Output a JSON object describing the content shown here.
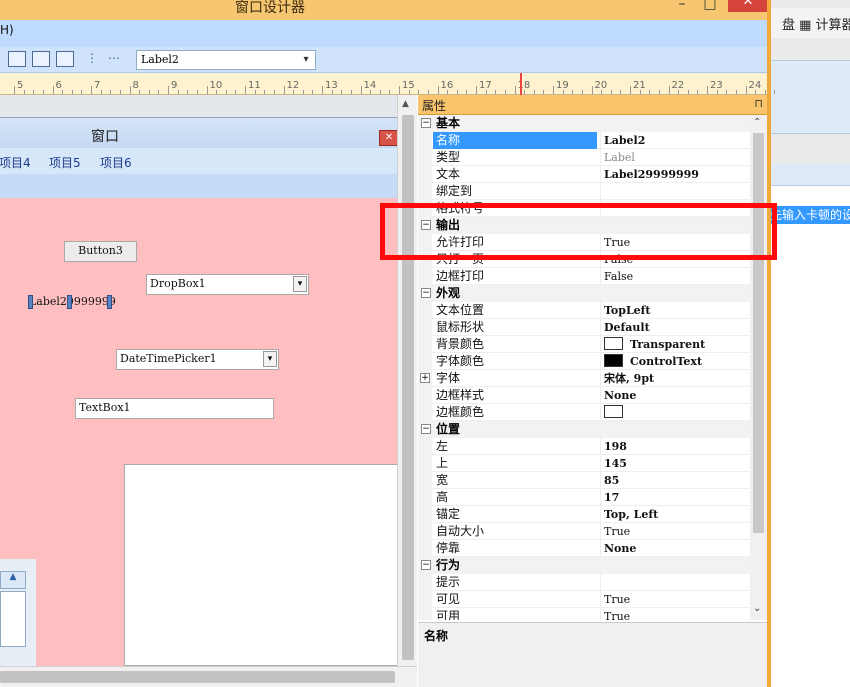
{
  "window": {
    "title": "窗口设计器",
    "min": "–",
    "max": "□",
    "close": "✕"
  },
  "outer": {
    "toolbar_text": "盘  ▦ 计算器",
    "selected_text": "先输入卡顿的设"
  },
  "menu": {
    "partial_item": "H)"
  },
  "toolbar": {
    "combo_value": "Label2",
    "combo_arrow": "▾"
  },
  "ruler": {
    "labels": [
      "5",
      "6",
      "7",
      "8",
      "9",
      "10",
      "11",
      "12",
      "13",
      "14",
      "15",
      "16",
      "17",
      "18",
      "19",
      "20",
      "21",
      "22",
      "23",
      "24"
    ]
  },
  "form": {
    "title": "窗口",
    "close": "✕",
    "menu_items": [
      "项目4",
      "项目5",
      "项目6"
    ],
    "controls": {
      "button3": "Button3",
      "dropbox": "DropBox1",
      "label2": "Label29999999",
      "datetime": "DateTimePicker1",
      "textbox": "TextBox1"
    },
    "lp_btn": "▲"
  },
  "properties": {
    "header": "属性",
    "pin": "⊓",
    "categories": [
      {
        "name": "基本",
        "rows": [
          {
            "name": "名称",
            "value": "Label2",
            "bold": true,
            "selected": true
          },
          {
            "name": "类型",
            "value": "Label",
            "grey": true
          },
          {
            "name": "文本",
            "value": "Label29999999",
            "bold": true
          },
          {
            "name": "绑定到",
            "value": ""
          },
          {
            "name": "格式符号",
            "value": ""
          }
        ]
      },
      {
        "name": "输出",
        "rows": [
          {
            "name": "允许打印",
            "value": "True"
          },
          {
            "name": "只打一页",
            "value": "False"
          },
          {
            "name": "边框打印",
            "value": "False"
          }
        ]
      },
      {
        "name": "外观",
        "rows": [
          {
            "name": "文本位置",
            "value": "TopLeft",
            "bold": true
          },
          {
            "name": "鼠标形状",
            "value": "Default",
            "bold": true
          },
          {
            "name": "背景颜色",
            "value": "Transparent",
            "bold": true,
            "swatch": "#ffffff"
          },
          {
            "name": "字体颜色",
            "value": "ControlText",
            "bold": true,
            "swatch": "#000000"
          },
          {
            "name": "字体",
            "value": "宋体, 9pt",
            "bold": true,
            "expander": true
          },
          {
            "name": "边框样式",
            "value": "None",
            "bold": true
          },
          {
            "name": "边框颜色",
            "value": "",
            "swatch": "#ffffff"
          }
        ]
      },
      {
        "name": "位置",
        "rows": [
          {
            "name": "左",
            "value": "198",
            "bold": true
          },
          {
            "name": "上",
            "value": "145",
            "bold": true
          },
          {
            "name": "宽",
            "value": "85",
            "bold": true
          },
          {
            "name": "高",
            "value": "17",
            "bold": true
          },
          {
            "name": "锚定",
            "value": "Top, Left",
            "bold": true
          },
          {
            "name": "自动大小",
            "value": "True"
          },
          {
            "name": "停靠",
            "value": "None",
            "bold": true
          }
        ]
      },
      {
        "name": "行为",
        "rows": [
          {
            "name": "提示",
            "value": ""
          },
          {
            "name": "可见",
            "value": "True"
          },
          {
            "name": "可用",
            "value": "True"
          }
        ]
      }
    ],
    "description_title": "名称",
    "collapse_glyph": "⊟",
    "expand_glyph": "⊞"
  },
  "colors": {
    "highlight": "#ff0a0a",
    "selection": "#3399ff",
    "form_body": "#ffbfc0"
  }
}
